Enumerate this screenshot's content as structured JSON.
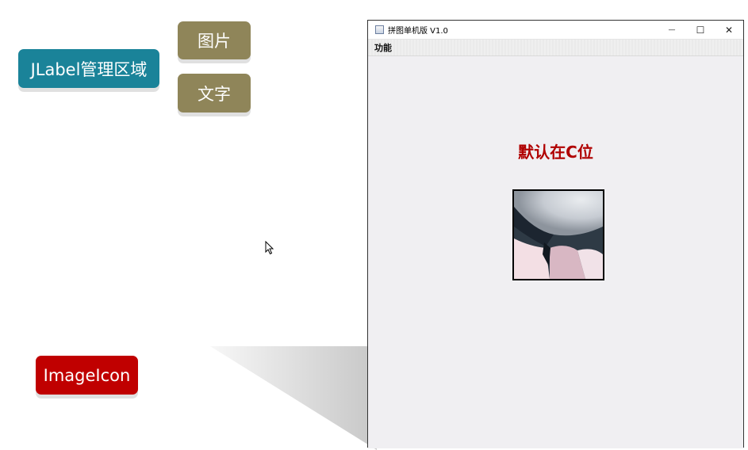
{
  "slide": {
    "jlabel_area": "JLabel管理区域",
    "picture": "图片",
    "text": "文字",
    "imageicon": "ImageIcon"
  },
  "window": {
    "title": "拼图单机版 V1.0",
    "minimize_glyph": "—",
    "maximize_glyph": "☐",
    "close_glyph": "✕",
    "menu": [
      "功能"
    ]
  },
  "content": {
    "label_text": "默认在C位"
  },
  "colors": {
    "teal": "#1a8399",
    "olive": "#8f8559",
    "red": "#c00000",
    "label_red": "#b00000"
  }
}
